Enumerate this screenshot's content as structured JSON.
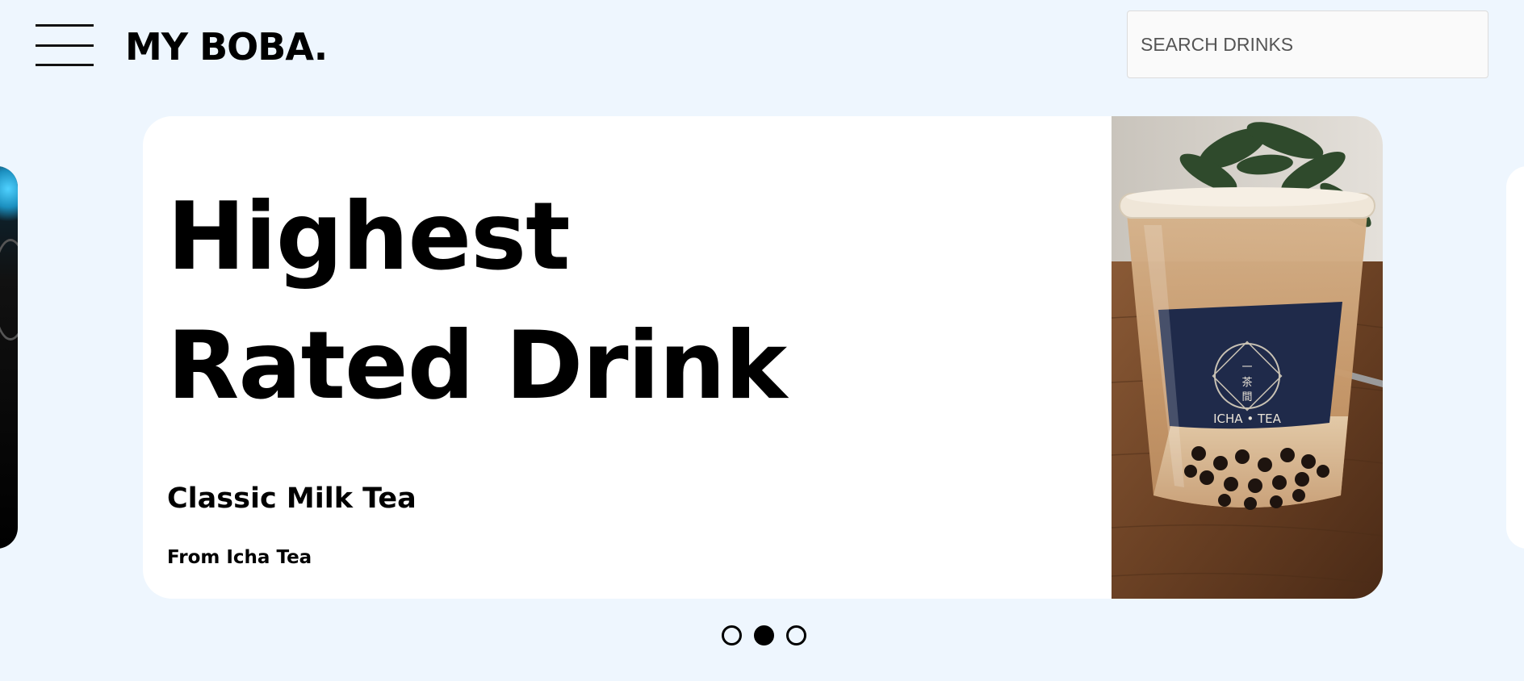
{
  "header": {
    "brand": "MY BOBA.",
    "search_placeholder": "SEARCH DRINKS",
    "menu_icon": "hamburger-menu-icon"
  },
  "carousel": {
    "active_index": 1,
    "slide_count": 3,
    "slide": {
      "heading": "Highest Rated Drink",
      "drink_name": "Classic Milk Tea",
      "source": "From Icha Tea",
      "image_sleeve_text": "ICHA • TEA"
    }
  },
  "colors": {
    "page_background": "#eef6fe",
    "card_background": "#ffffff",
    "text": "#000000"
  }
}
